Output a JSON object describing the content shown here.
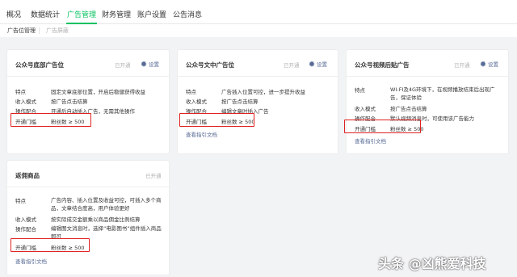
{
  "topnav": {
    "tabs": [
      {
        "label": "概况"
      },
      {
        "label": "数据统计"
      },
      {
        "label": "广告管理",
        "active": true
      },
      {
        "label": "财务管理"
      },
      {
        "label": "账户设置"
      },
      {
        "label": "公告消息"
      }
    ]
  },
  "subnav": {
    "items": [
      {
        "label": "广告位管理",
        "active": true
      },
      {
        "label": "广告屏蔽",
        "active": false
      }
    ]
  },
  "cards": [
    {
      "title": "公众号底部广告位",
      "status": "已开通",
      "setting": "设置",
      "rows": [
        {
          "k": "特点",
          "v": "固定文章底部位置，开启后稳健获得收益"
        },
        {
          "k": "收入模式",
          "v": "按广告点击结算"
        },
        {
          "k": "操作配合",
          "v": "开通后自动插入广告，无需其他操作"
        },
        {
          "k": "开通门槛",
          "v": "粉丝数 ≥ 500"
        }
      ]
    },
    {
      "title": "公众号文中广告位",
      "status": "已开通",
      "setting": "设置",
      "rows": [
        {
          "k": "特点",
          "v": "广告插入位置可控，进一步提升收益"
        },
        {
          "k": "收入模式",
          "v": "按广告点击结算"
        },
        {
          "k": "操作配合",
          "v": "编辑文章时插入广告"
        },
        {
          "k": "开通门槛",
          "v": "粉丝数 ≥ 500"
        }
      ],
      "link": "查看指引文档"
    },
    {
      "title": "公众号视频后贴广告",
      "status": "已开通",
      "setting": "设置",
      "rows": [
        {
          "k": "特点",
          "v": "WI-FI及4G环境下，在视频播放结束后出现广告，保证体验"
        },
        {
          "k": "收入模式",
          "v": "按广告点击结算"
        },
        {
          "k": "操作配合",
          "v": "默认视频消息时，可使用该广告能力"
        },
        {
          "k": "开通门槛",
          "v": "粉丝数 ≥ 500"
        }
      ],
      "link": "查看指引文档"
    },
    {
      "title": "返佣商品",
      "status": "已开通",
      "rows": [
        {
          "k": "特点",
          "v": "广告内容、插入位置及收益可控，可插入多个商品，文章结合度高，用户体验更好"
        },
        {
          "k": "收入模式",
          "v": "按实际成交金额乘以商品佣金比例结算"
        },
        {
          "k": "操作配合",
          "v": "编辑图文消息时，选择“电影图书”组件插入商品即可"
        },
        {
          "k": "开通门槛",
          "v": "粉丝数 ≥ 500"
        }
      ],
      "link": "查看指引文档"
    }
  ],
  "watermark": "头条 @凶熊爱科技",
  "colors": {
    "accent": "#07c160",
    "link": "#576b95",
    "highlight_box": "#e02020"
  }
}
